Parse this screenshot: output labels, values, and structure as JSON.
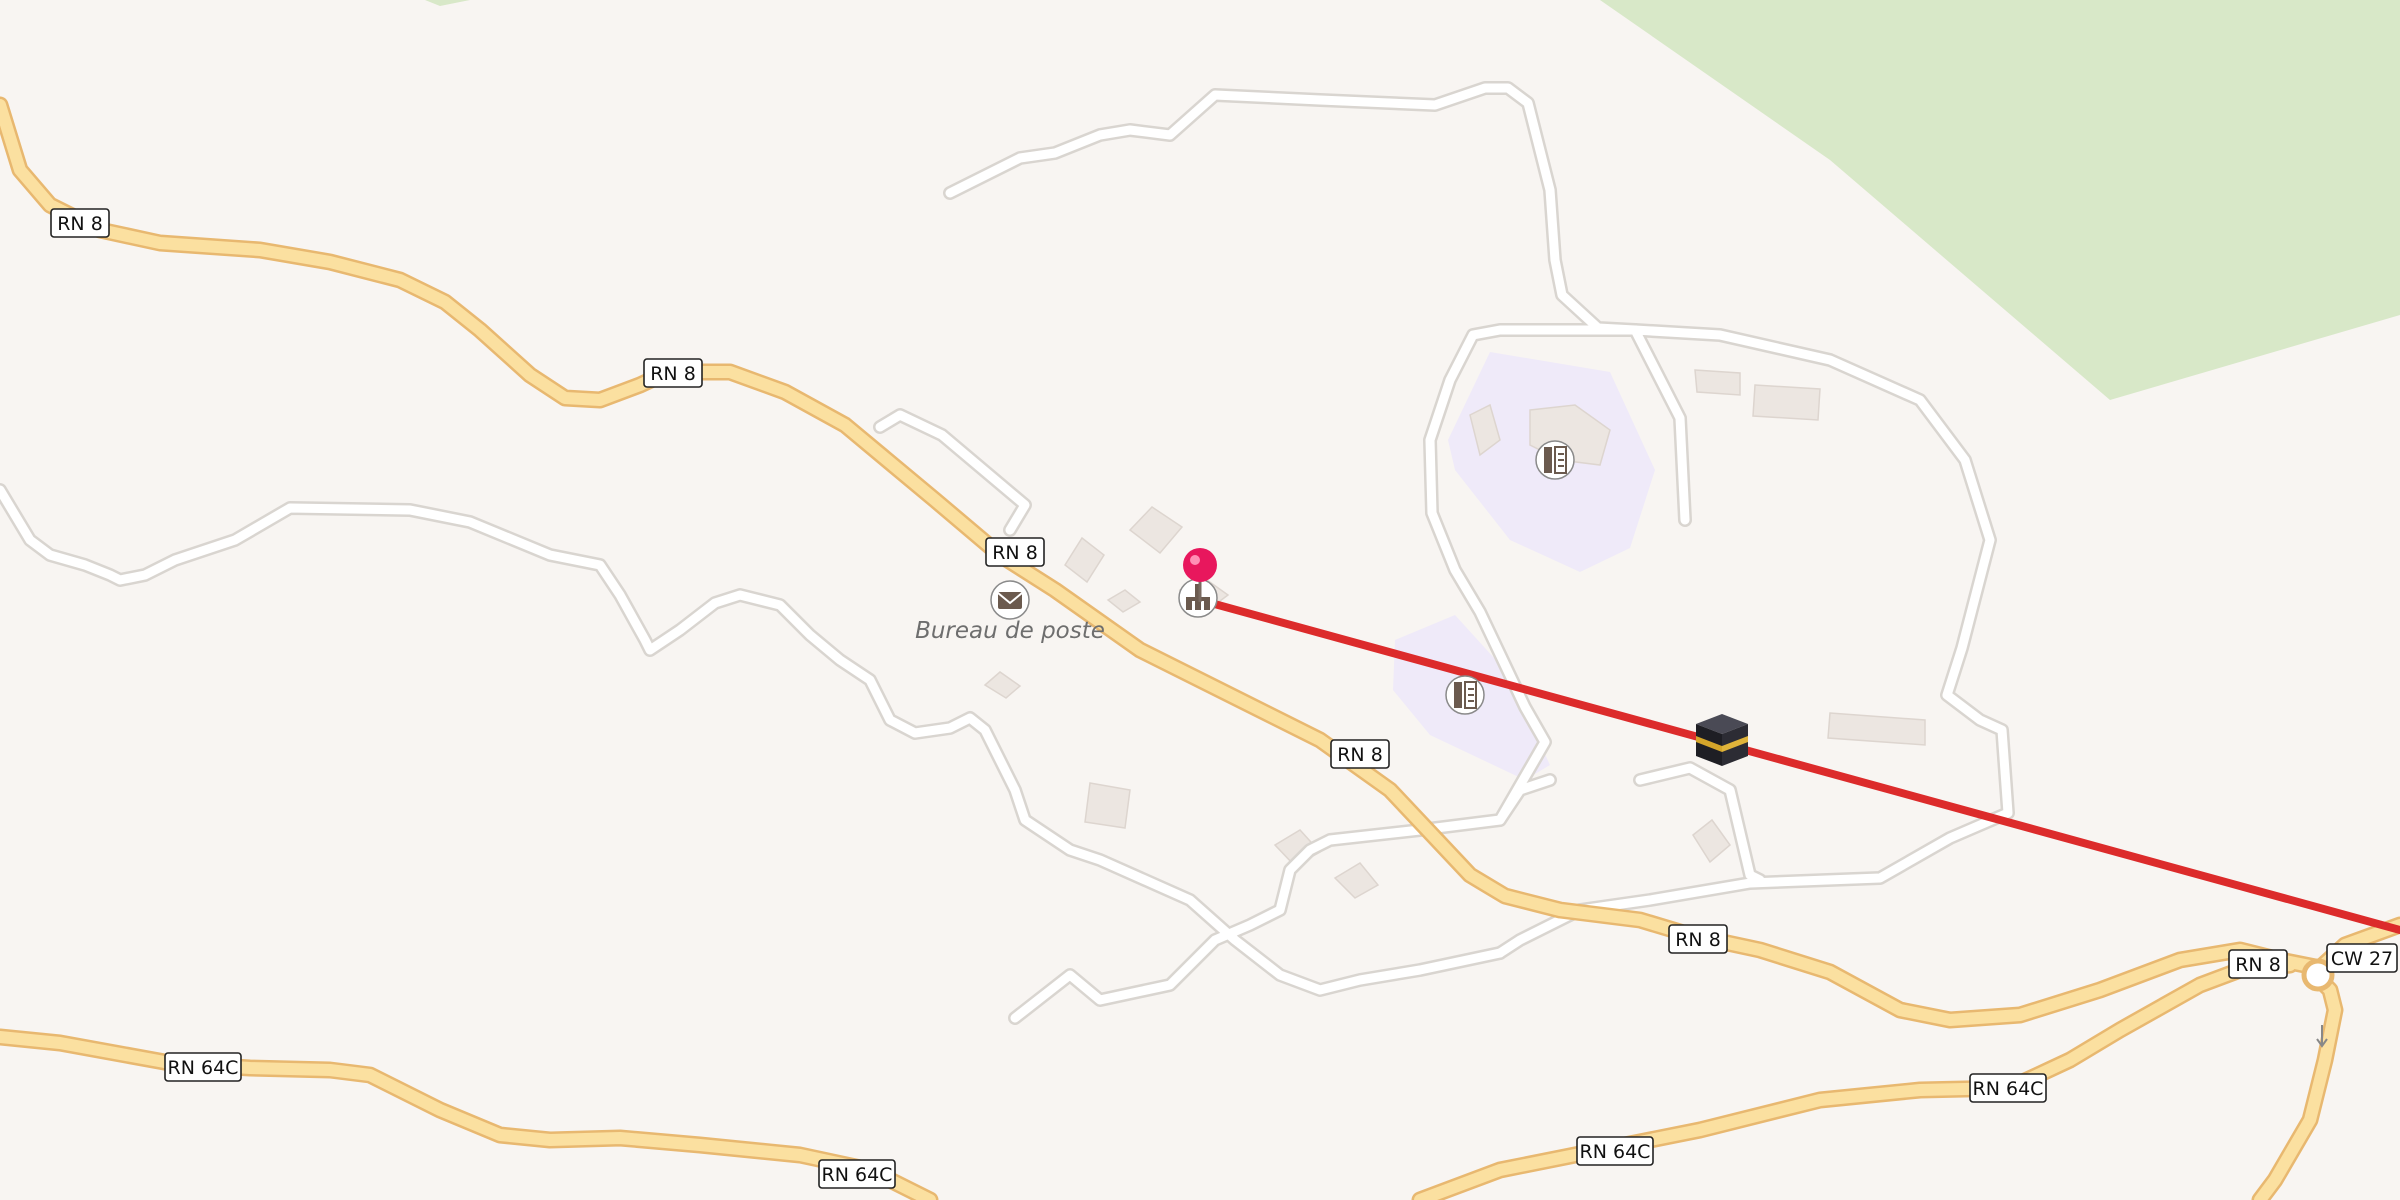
{
  "map": {
    "place_labels": {
      "post_office": "Bureau de poste"
    },
    "road_shields": {
      "rn8_a": "RN 8",
      "rn8_b": "RN 8",
      "rn8_c": "RN 8",
      "rn8_d": "RN 8",
      "rn8_e": "RN 8",
      "rn8_f": "RN 8",
      "cw27": "CW 27",
      "rn64c_a": "RN 64C",
      "rn64c_b": "RN 64C",
      "rn64c_c": "RN 64C",
      "rn64c_d": "RN 64C"
    },
    "icons": {
      "location_pin": "location-pin-icon",
      "post_office": "envelope-icon",
      "mosque": "mosque-icon",
      "school_a": "school-icon",
      "school_b": "school-icon",
      "qibla": "kaaba-icon"
    },
    "colors": {
      "background": "#f8f5f2",
      "forest": "#d8e8c8",
      "primary_road": "#fbe0a0",
      "primary_road_casing": "#e8b870",
      "minor_road": "#ffffff",
      "minor_road_casing": "#d9d5d0",
      "school_area": "#efeaf9",
      "building": "#ece6e1",
      "direction_line": "#dc2b2b",
      "pin": "#e8175d"
    }
  }
}
